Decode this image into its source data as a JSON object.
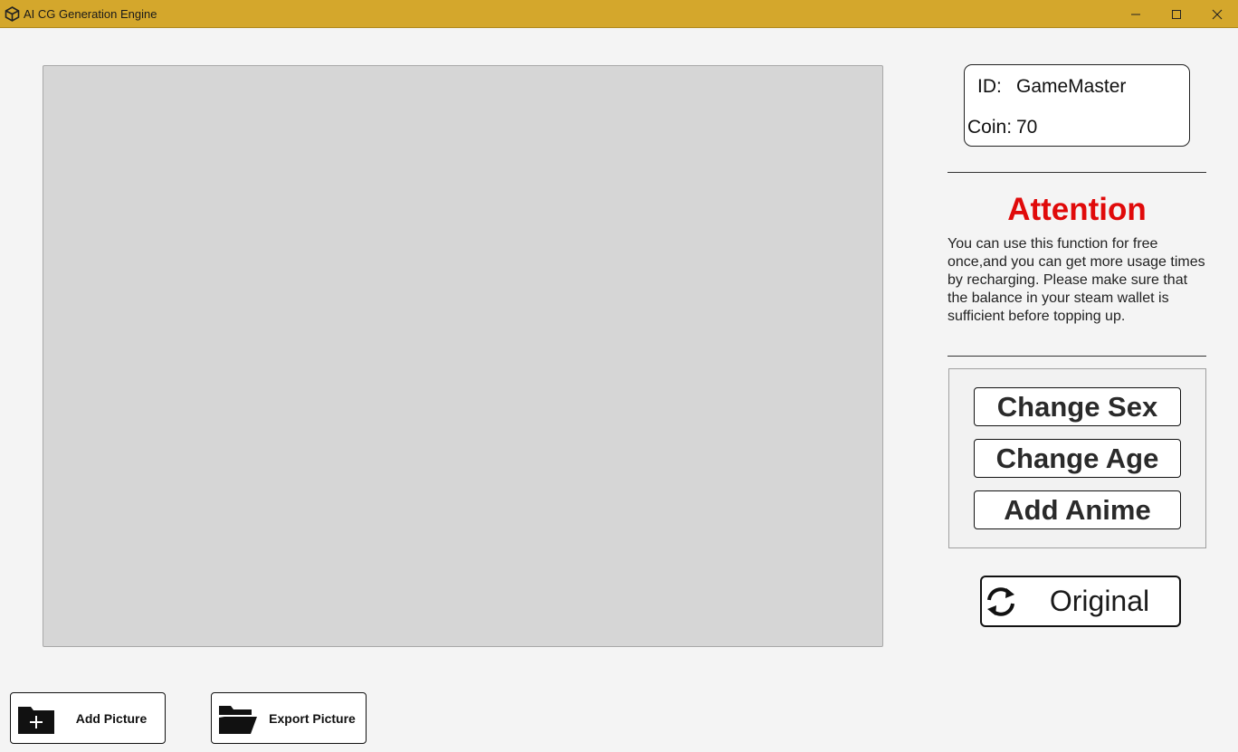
{
  "window": {
    "title": "AI CG Generation Engine",
    "app_icon": "unity-logo-icon",
    "controls": [
      "minimize-icon",
      "maximize-icon",
      "close-icon"
    ]
  },
  "account": {
    "id_label": "ID:",
    "id_value": "GameMaster",
    "coin_label": "Coin:",
    "coin_value": "70"
  },
  "notice": {
    "title": "Attention",
    "text": "You can use this function for free once,and you can get more usage times by recharging. Please make sure that the balance in your steam wallet is sufficient before topping up."
  },
  "actions": {
    "change_sex": "Change Sex",
    "change_age": "Change Age",
    "add_anime": "Add Anime",
    "original": "Original"
  },
  "bottom": {
    "add_picture": "Add Picture",
    "export_picture": "Export Picture"
  },
  "colors": {
    "titlebar": "#d4a72c",
    "attention": "#e00a0a",
    "canvas": "#d6d6d6",
    "background": "#f4f4f4"
  }
}
